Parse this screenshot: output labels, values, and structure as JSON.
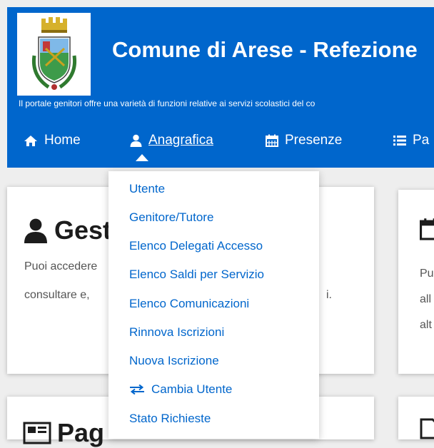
{
  "header": {
    "title": "Comune di Arese - Refezione",
    "tagline": "Il portale genitori offre una varietà di funzioni relative ai servizi scolastici del co",
    "logo_icon": "coat-of-arms-icon"
  },
  "nav": {
    "items": [
      {
        "label": "Home",
        "icon": "home-icon"
      },
      {
        "label": "Anagrafica",
        "icon": "user-icon",
        "active": true
      },
      {
        "label": "Presenze",
        "icon": "calendar-icon"
      },
      {
        "label": "Pa",
        "icon": "list-icon"
      }
    ]
  },
  "dropdown": {
    "items": [
      {
        "label": "Utente"
      },
      {
        "label": "Genitore/Tutore"
      },
      {
        "label": "Elenco Delegati Accesso"
      },
      {
        "label": "Elenco Saldi per Servizio"
      },
      {
        "label": "Elenco Comunicazioni"
      },
      {
        "label": "Rinnova Iscrizioni"
      },
      {
        "label": "Nuova Iscrizione"
      },
      {
        "label": "Cambia Utente",
        "icon": "swap-icon"
      },
      {
        "label": "Stato Richieste"
      }
    ]
  },
  "cards": {
    "card1": {
      "title": "Gest",
      "icon": "user-icon",
      "line1": "Puoi accedere",
      "line2": "consultare e,",
      "tail": "i."
    },
    "card2": {
      "icon": "calendar-icon",
      "line1": "Pu",
      "line2": "all",
      "line3": "alt"
    },
    "card3": {
      "title": "Pag",
      "icon": "newspaper-icon"
    },
    "card4": {
      "icon": "document-icon"
    }
  },
  "colors": {
    "brand": "#0066cc",
    "link": "#0066cc",
    "background": "#eeeeee"
  }
}
